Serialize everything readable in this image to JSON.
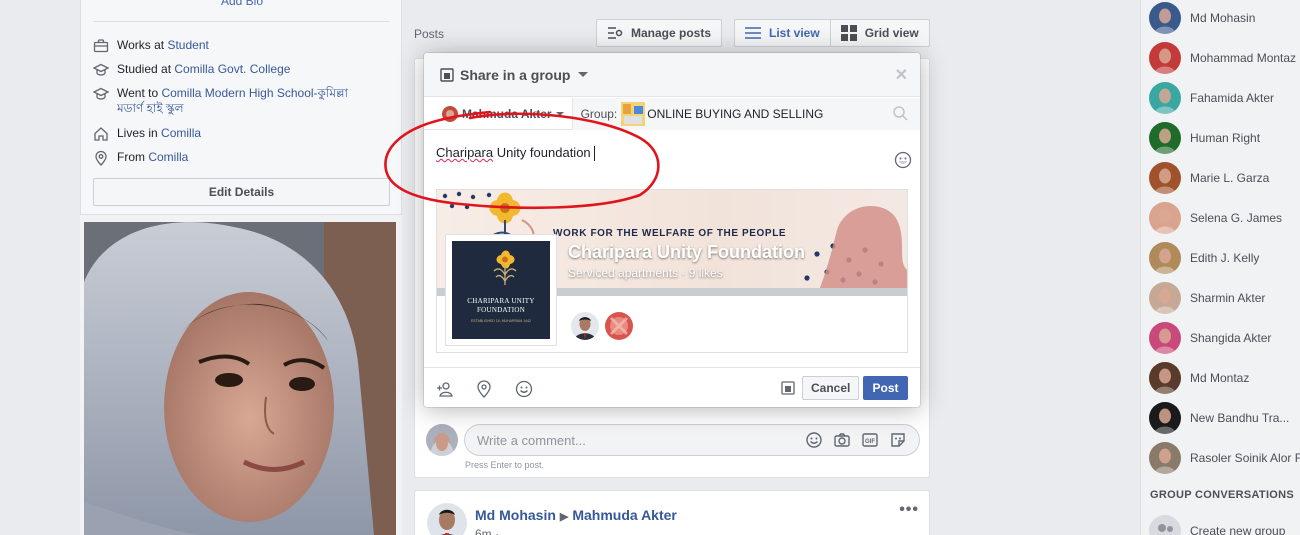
{
  "intro": {
    "add_bio": "Add Bio",
    "works_prefix": "Works at ",
    "works_link": "Student",
    "studied_prefix": "Studied at ",
    "studied_link": "Comilla Govt. College",
    "went_prefix": "Went to ",
    "went_link_line1": "Comilla Modern High School-কুমিল্লা",
    "went_link_line2": "মডার্ণ হাই স্কুল",
    "lives_prefix": "Lives in ",
    "lives_link": "Comilla",
    "from_prefix": "From ",
    "from_link": "Comilla",
    "edit_details": "Edit Details"
  },
  "feed": {
    "posts_label": "Posts",
    "manage_posts": "Manage posts",
    "list_view": "List view",
    "grid_view": "Grid view",
    "comment_placeholder": "Write a comment...",
    "press_enter": "Press Enter to post.",
    "post_author": "Md Mohasin",
    "post_target": "Mahmuda Akter",
    "post_time": "6m ·"
  },
  "modal": {
    "title": "Share in a group",
    "user": "Mahmuda Akter",
    "group_label": "Group:",
    "group_name": "ONLINE BUYING AND SELLING",
    "text_underlined": "Charipara",
    "text_rest": " Unity foundation",
    "cover_tagline": "WORK FOR THE WELFARE OF THE PEOPLE",
    "page_title": "Charipara Unity Foundation",
    "page_sub": "Serviced apartments · 9 likes",
    "thumb_name_line1": "CHARIPARA UNITY",
    "thumb_name_line2": "FOUNDATION",
    "thumb_small": "ESTABLISHED 16, MUHARRAM 1442",
    "cancel": "Cancel",
    "post": "Post"
  },
  "contacts": [
    {
      "name": "Md Mohasin",
      "color": "#3b5a8c"
    },
    {
      "name": "Mohammad Montaz",
      "color": "#c23a3a"
    },
    {
      "name": "Fahamida Akter",
      "color": "#3aa7a0"
    },
    {
      "name": "Human Right",
      "color": "#1f6b2c"
    },
    {
      "name": "Marie L. Garza",
      "color": "#a0522d"
    },
    {
      "name": "Selena G. James",
      "color": "#d9a38f"
    },
    {
      "name": "Edith J. Kelly",
      "color": "#b08a5a"
    },
    {
      "name": "Sharmin Akter",
      "color": "#c7a795"
    },
    {
      "name": "Shangida Akter",
      "color": "#c94a7a"
    },
    {
      "name": "Md Montaz",
      "color": "#5a3a2a"
    },
    {
      "name": "New Bandhu Tra...",
      "color": "#1a1a1a"
    },
    {
      "name": "Rasoler Soinik Alor F",
      "color": "#8a7a6a"
    }
  ],
  "group_conversations": "GROUP CONVERSATIONS",
  "create_group": "Create new group"
}
